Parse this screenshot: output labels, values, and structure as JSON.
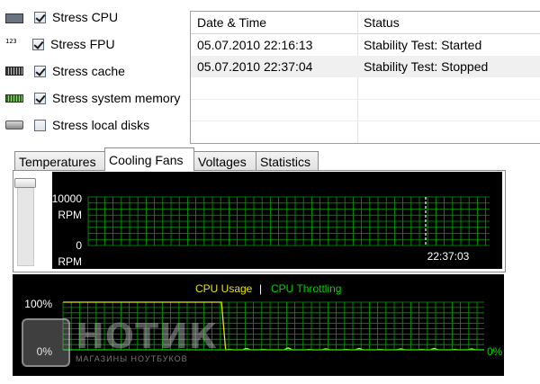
{
  "stress_options": [
    {
      "label": "Stress CPU",
      "checked": true,
      "icon": "cpu-icon"
    },
    {
      "label": "Stress FPU",
      "checked": true,
      "icon": "fpu-icon"
    },
    {
      "label": "Stress cache",
      "checked": true,
      "icon": "cache-icon"
    },
    {
      "label": "Stress system memory",
      "checked": true,
      "icon": "memory-icon"
    },
    {
      "label": "Stress local disks",
      "checked": false,
      "icon": "disk-icon"
    }
  ],
  "icons": {
    "fpu_text": "123"
  },
  "log": {
    "headers": {
      "datetime": "Date & Time",
      "status": "Status"
    },
    "rows": [
      {
        "datetime": "05.07.2010 22:16:13",
        "status": "Stability Test: Started"
      },
      {
        "datetime": "05.07.2010 22:37:04",
        "status": "Stability Test: Stopped"
      }
    ]
  },
  "tabs": [
    {
      "label": "Temperatures",
      "active": false
    },
    {
      "label": "Cooling Fans",
      "active": true
    },
    {
      "label": "Voltages",
      "active": false
    },
    {
      "label": "Statistics",
      "active": false
    }
  ],
  "fan_chart": {
    "y_max_label": "10000",
    "y_max_unit": "RPM",
    "y_min_label": "0",
    "y_min_unit": "RPM",
    "time_label": "22:37:03"
  },
  "cpu_chart": {
    "legend_usage": "CPU Usage",
    "legend_separator": "|",
    "legend_throttling": "CPU Throttling",
    "y_top_label": "100%",
    "y_bottom_label": "0%",
    "throttling_value_label": "0%"
  },
  "watermark": {
    "text": "НОТИК",
    "subtext": "МАГАЗИНЫ НОУТБУКОВ"
  },
  "colors": {
    "grid": "#00a000",
    "usage": "#e6e600",
    "throttling": "#00d200",
    "chart_text": "#ffffff"
  },
  "chart_data": [
    {
      "type": "line",
      "title": "",
      "ylabel": "RPM",
      "ylim": [
        0,
        10000
      ],
      "series": [],
      "marker_time": "22:37:03"
    },
    {
      "type": "line",
      "ylim": [
        0,
        100
      ],
      "series": [
        {
          "name": "CPU Usage",
          "values": [
            100,
            100,
            100,
            100,
            100,
            100,
            100,
            100,
            100,
            100,
            100,
            100,
            100,
            100,
            100,
            100,
            100,
            100,
            100,
            100,
            100,
            100,
            100,
            100,
            100,
            100,
            100,
            100,
            100,
            100,
            100,
            100,
            100,
            100,
            100,
            100,
            100,
            100,
            100,
            0,
            1,
            0,
            0,
            0,
            3,
            0,
            0,
            0,
            1,
            0,
            0,
            0,
            0,
            0,
            4,
            0,
            0,
            0,
            0,
            1,
            0,
            0,
            0,
            2,
            0,
            0,
            0,
            0,
            1,
            0,
            0,
            3,
            0,
            0,
            0,
            0,
            1,
            0,
            0,
            0,
            0,
            2,
            0,
            0,
            0,
            0,
            1,
            0,
            0,
            3,
            0,
            0,
            0,
            0,
            1,
            0,
            0,
            0,
            2,
            0,
            0,
            0
          ]
        },
        {
          "name": "CPU Throttling",
          "values": [
            0,
            0,
            0,
            0,
            0,
            0,
            0,
            0,
            0,
            0,
            0,
            0,
            0,
            0,
            0,
            0,
            0,
            0,
            0,
            0,
            0,
            0,
            0,
            0,
            0,
            0,
            0,
            0,
            0,
            0,
            0,
            0,
            0,
            0,
            0,
            0,
            0,
            0,
            0,
            0,
            0,
            0,
            0,
            0,
            0,
            0,
            0,
            0,
            0,
            0,
            0,
            0,
            0,
            0,
            0,
            0,
            0,
            0,
            0,
            0,
            0,
            0,
            0,
            0,
            0,
            0,
            0,
            0,
            0,
            0,
            0,
            0,
            0,
            0,
            0,
            0,
            0,
            0,
            0,
            0,
            0,
            0,
            0,
            0,
            0,
            0,
            0,
            0,
            0,
            0,
            0,
            0,
            0,
            0,
            0,
            0,
            0,
            0,
            0,
            0,
            0
          ]
        }
      ]
    }
  ]
}
